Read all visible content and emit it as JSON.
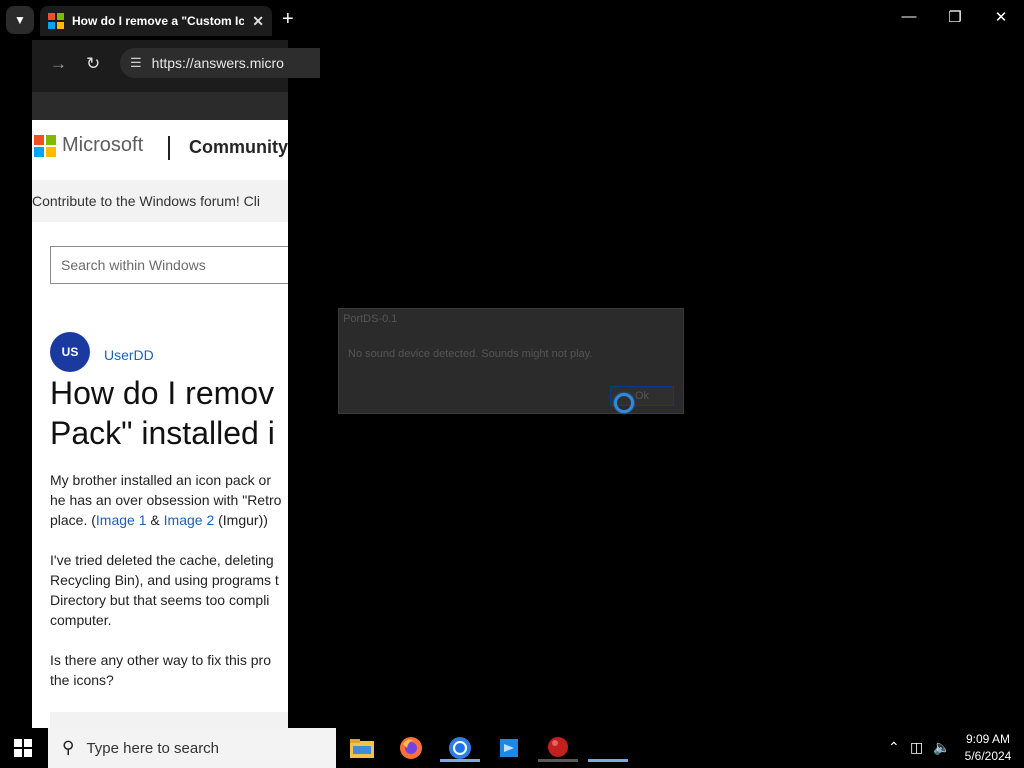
{
  "browser": {
    "tab_title": "How do I remove a \"Custom Ic",
    "address": "https://answers.micro",
    "window_controls": [
      "minimize-icon",
      "restore-icon",
      "close-icon"
    ]
  },
  "page": {
    "brand": "Microsoft",
    "community": "Community",
    "banner": "Contribute to the Windows forum!  Cli",
    "search_placeholder": "Search within Windows",
    "avatar_initials": "US",
    "username": "UserDD",
    "question_line1": "How do I remov",
    "question_line2": "Pack\" installed i",
    "para1_line1": "My brother installed an icon pack or",
    "para1_line2": "he has an over obsession with \"Retro",
    "para1_line3_pre": "place. (",
    "image1": "Image 1",
    "amp": " & ",
    "image2": "Image 2",
    "para1_line3_post": " (Imgur))",
    "para2_line1": "I've tried deleted the cache, deleting",
    "para2_line2": "Recycling Bin), and using programs t",
    "para2_line3": "Directory but that seems too compli",
    "para2_line4": "computer.",
    "para3_line1": "Is there any other way to fix this pro",
    "para3_line2": "the icons?"
  },
  "dialog": {
    "title": "PortDS-0.1",
    "message": "No sound device detected. Sounds might not play.",
    "ok_label": "Ok"
  },
  "taskbar": {
    "search_placeholder": "Type here to search",
    "apps": [
      "file-explorer-icon",
      "firefox-icon",
      "chrome-icon",
      "vscode-icon",
      "red-ball-app-icon"
    ],
    "time": "9:09 AM",
    "date": "5/6/2024"
  },
  "colors": {
    "ms_red": "#f25022",
    "ms_green": "#7fba00",
    "ms_blue": "#00a4ef",
    "ms_yellow": "#ffb900",
    "link": "#1a62b5",
    "avatar": "#1a3aa0"
  }
}
